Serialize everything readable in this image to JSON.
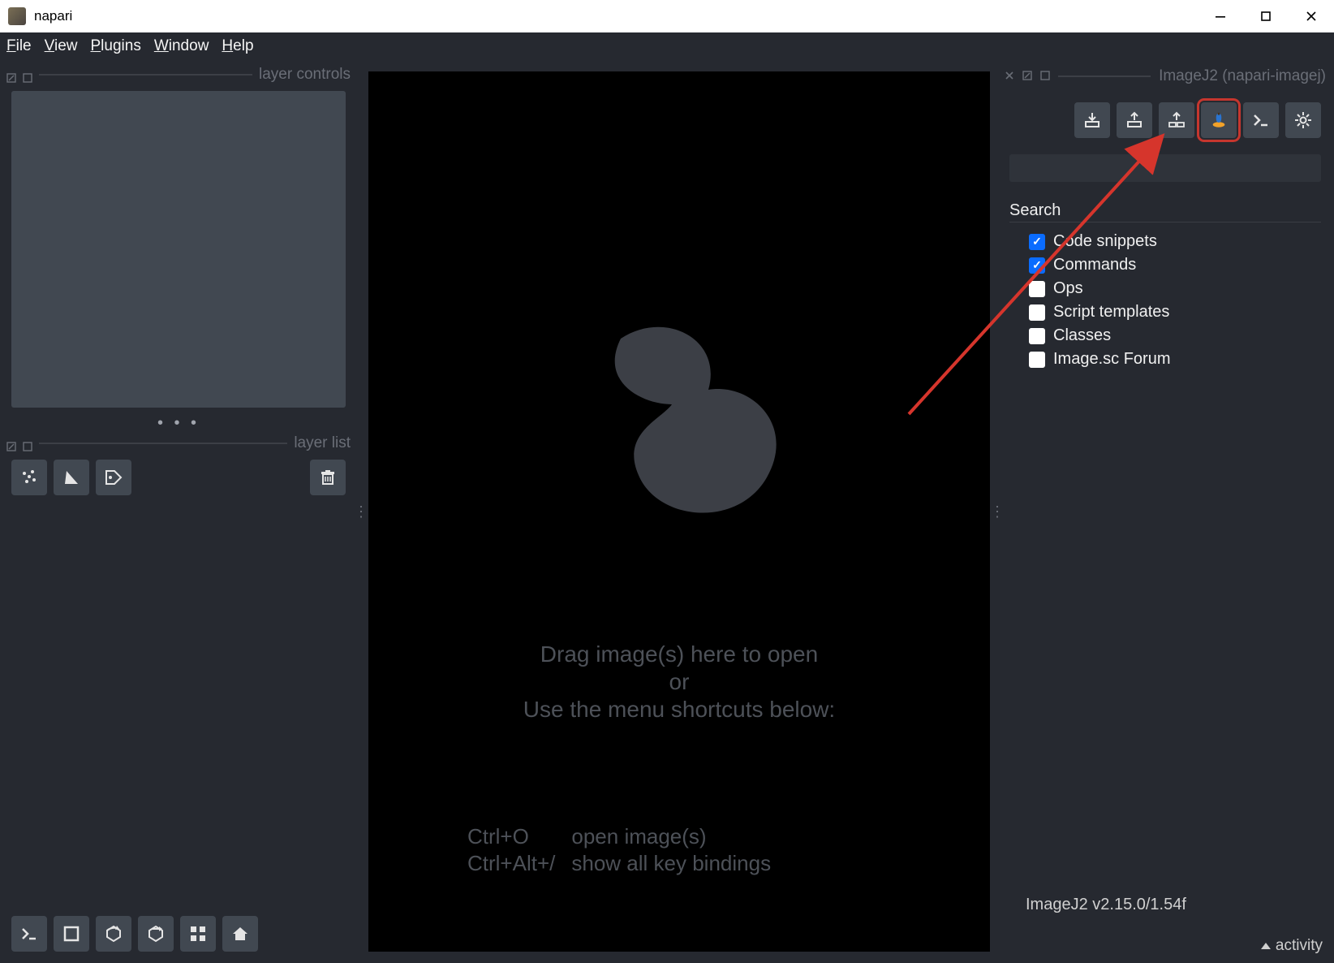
{
  "window": {
    "title": "napari"
  },
  "menubar": {
    "items": [
      "File",
      "View",
      "Plugins",
      "Window",
      "Help"
    ]
  },
  "left": {
    "controls_label": "layer controls",
    "list_label": "layer list"
  },
  "canvas": {
    "hint1": "Drag image(s) here to open",
    "hint2": "or",
    "hint3": "Use the menu shortcuts below:",
    "shortcuts": [
      {
        "keys": "Ctrl+O",
        "desc": "open image(s)"
      },
      {
        "keys": "Ctrl+Alt+/",
        "desc": "show all key bindings"
      }
    ]
  },
  "plugin": {
    "title": "ImageJ2  (napari-imagej)",
    "toolbar_icons": [
      "import-icon",
      "export-icon",
      "export-all-icon",
      "imagej-gui-icon",
      "script-console-icon",
      "settings-icon"
    ],
    "search_label": "Search",
    "search_value": "",
    "filters": [
      {
        "label": "Code snippets",
        "checked": true
      },
      {
        "label": "Commands",
        "checked": true
      },
      {
        "label": "Ops",
        "checked": false
      },
      {
        "label": "Script templates",
        "checked": false
      },
      {
        "label": "Classes",
        "checked": false
      },
      {
        "label": "Image.sc Forum",
        "checked": false
      }
    ],
    "version": "ImageJ2 v2.15.0/1.54f"
  },
  "statusbar": {
    "activity_label": "activity"
  },
  "annotation": {
    "highlight_toolbar_index": 3
  }
}
